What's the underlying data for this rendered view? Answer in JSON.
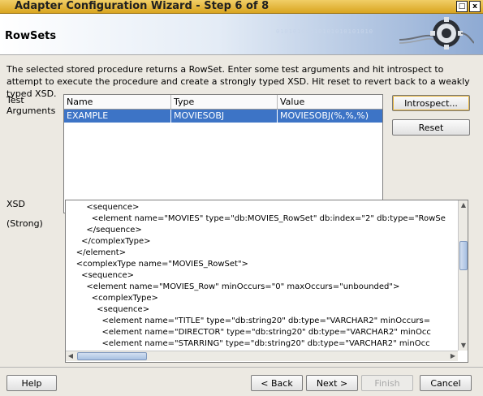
{
  "window": {
    "title": "Adapter Configuration Wizard - Step 6 of 8",
    "close_glyph": "x",
    "max_glyph": "□"
  },
  "header": {
    "title": "RowSets",
    "binary": "01010100010101010101010"
  },
  "description": "The selected stored procedure returns a RowSet.  Enter some test arguments and hit introspect to attempt to execute the procedure and create a strongly typed XSD.  Hit reset to revert back to a weakly typed XSD.",
  "test_args": {
    "label_line1": "Test",
    "label_line2": "Arguments",
    "columns": [
      "Name",
      "Type",
      "Value"
    ],
    "rows": [
      {
        "name": "EXAMPLE",
        "type": "MOVIESOBJ",
        "value": "MOVIESOBJ(%,%,%)"
      }
    ]
  },
  "buttons": {
    "introspect": "Introspect...",
    "reset": "Reset",
    "help": "Help",
    "back": "< Back",
    "next": "Next >",
    "finish": "Finish",
    "cancel": "Cancel"
  },
  "xsd": {
    "label": "XSD",
    "mode": "(Strong)",
    "lines": [
      "        <sequence>",
      "          <element name=\"MOVIES\" type=\"db:MOVIES_RowSet\" db:index=\"2\" db:type=\"RowSe",
      "        </sequence>",
      "      </complexType>",
      "    </element>",
      "    <complexType name=\"MOVIES_RowSet\">",
      "      <sequence>",
      "        <element name=\"MOVIES_Row\" minOccurs=\"0\" maxOccurs=\"unbounded\">",
      "          <complexType>",
      "            <sequence>",
      "              <element name=\"TITLE\" type=\"db:string20\" db:type=\"VARCHAR2\" minOccurs=",
      "              <element name=\"DIRECTOR\" type=\"db:string20\" db:type=\"VARCHAR2\" minOcc",
      "              <element name=\"STARRING\" type=\"db:string20\" db:type=\"VARCHAR2\" minOcc"
    ]
  },
  "colors": {
    "title_bar": "#d9a520",
    "selection": "#3d74c6",
    "header_gradient_end": "#8eaad3"
  },
  "icons": [
    "close-icon",
    "maximize-icon",
    "gear-icon",
    "scroll-up-icon",
    "scroll-down-icon",
    "scroll-left-icon",
    "scroll-right-icon"
  ]
}
